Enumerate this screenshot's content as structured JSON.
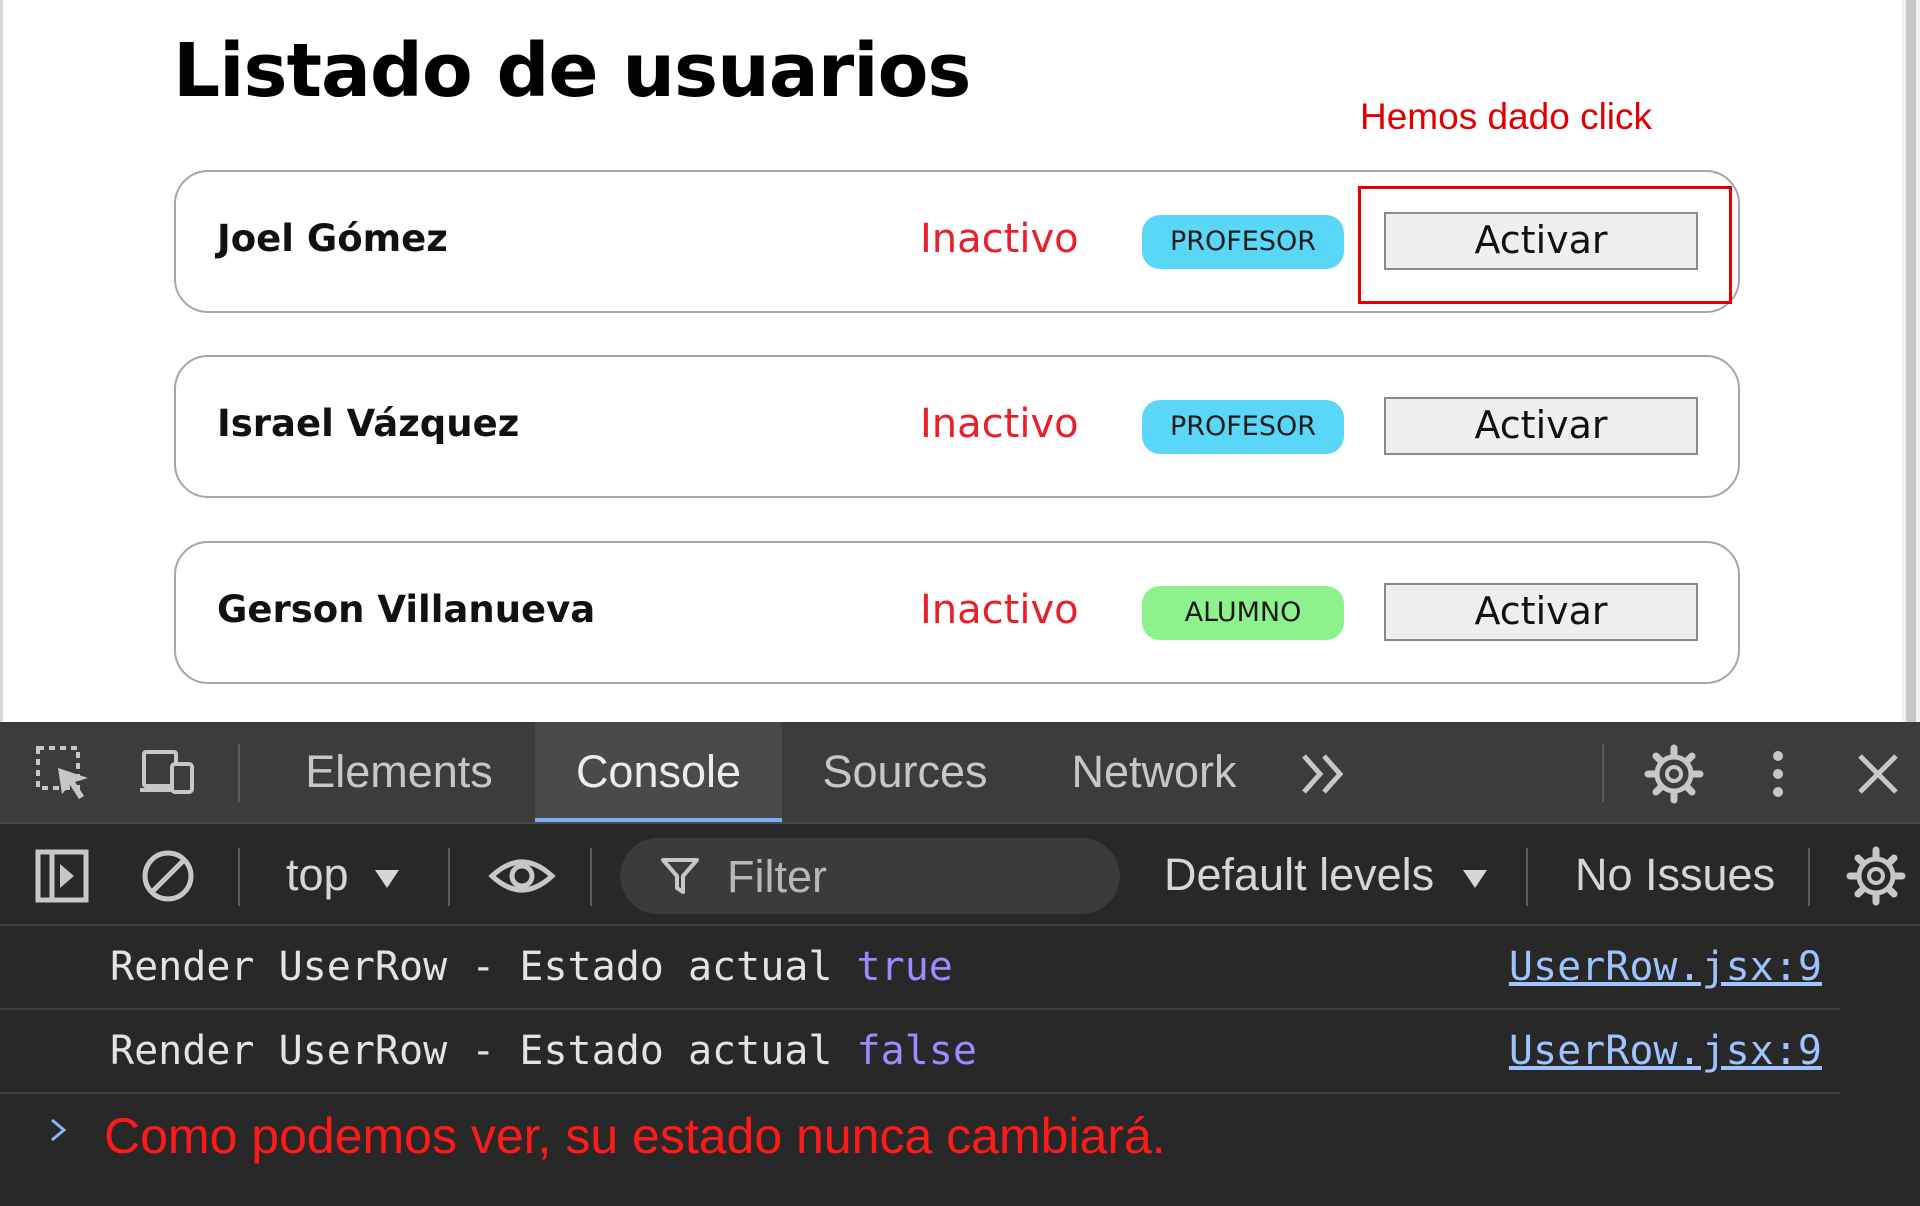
{
  "page": {
    "title": "Listado de usuarios",
    "annotation": "Hemos dado click",
    "users": [
      {
        "name": "Joel Gómez",
        "status": "Inactivo",
        "role": "PROFESOR",
        "button": "Activar"
      },
      {
        "name": "Israel Vázquez",
        "status": "Inactivo",
        "role": "PROFESOR",
        "button": "Activar"
      },
      {
        "name": "Gerson Villanueva",
        "status": "Inactivo",
        "role": "ALUMNO",
        "button": "Activar"
      }
    ],
    "colors": {
      "status_inactive": "#e8202a",
      "role_profesor": "#5ad7f6",
      "role_alumno": "#8df28c",
      "annotation": "#e00000"
    }
  },
  "devtools": {
    "tabs": [
      {
        "label": "Elements",
        "active": false
      },
      {
        "label": "Console",
        "active": true
      },
      {
        "label": "Sources",
        "active": false
      },
      {
        "label": "Network",
        "active": false
      }
    ],
    "icons": {
      "inspect": "inspect-element-icon",
      "device": "device-toolbar-icon",
      "more_tabs": "chevron-double-right-icon",
      "settings": "gear-icon",
      "menu": "more-vertical-icon",
      "close": "close-icon",
      "sidebar": "sidebar-toggle-icon",
      "clear": "clear-console-icon",
      "live_expression": "eye-icon",
      "filter": "filter-icon",
      "console_settings": "gear-icon"
    },
    "toolbar": {
      "context": "top",
      "filter_placeholder": "Filter",
      "levels": "Default levels",
      "issues": "No Issues"
    },
    "console": {
      "logs": [
        {
          "message": "Render UserRow - Estado actual ",
          "value": "true",
          "source": "UserRow.jsx:9"
        },
        {
          "message": "Render UserRow - Estado actual ",
          "value": "false",
          "source": "UserRow.jsx:9"
        }
      ],
      "note": "Como podemos ver, su estado nunca cambiará."
    }
  }
}
